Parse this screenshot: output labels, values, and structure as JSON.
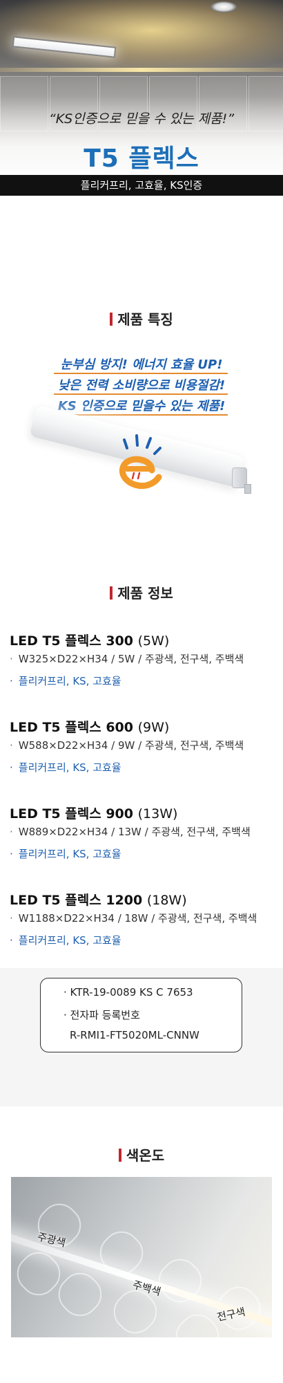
{
  "hero": {
    "quote": "“KS인증으로 믿을 수 있는 제품!”",
    "title": "T5 플렉스",
    "bar_text": "플리커프리, 고효율, KS인증"
  },
  "features": {
    "heading": "제품 특징",
    "lines": [
      "눈부심 방지!  에너지 효율 UP!",
      "낮은 전력 소비량으로 비용절감!",
      "KS 인증으로 믿을수 있는 제품!"
    ]
  },
  "info": {
    "heading": "제품 정보",
    "products": [
      {
        "name": "LED T5 플렉스 300",
        "watt": "(5W)",
        "spec": "W325×D22×H34  /  5W  /  주광색, 전구색, 주백색",
        "feature": "플리커프리, KS, 고효율"
      },
      {
        "name": "LED T5 플렉스 600",
        "watt": "(9W)",
        "spec": "W588×D22×H34  /  9W  /  주광색, 전구색, 주백색",
        "feature": "플리커프리, KS, 고효율"
      },
      {
        "name": "LED T5 플렉스 900",
        "watt": "(13W)",
        "spec": "W889×D22×H34  /  13W  /  주광색, 전구색, 주백색",
        "feature": "플리커프리, KS, 고효율"
      },
      {
        "name": "LED T5 플렉스 1200",
        "watt": "(18W)",
        "spec": "W1188×D22×H34  /  18W  /  주광색, 전구색, 주백색",
        "feature": "플리커프리, KS, 고효율"
      }
    ],
    "bullet": "·",
    "certs": {
      "line1": "· KTR-19-0089 KS C 7653",
      "line2": "· 전자파 등록번호",
      "line3": "R-RMI1-FT5020ML-CNNW"
    }
  },
  "color_temp": {
    "heading": "색온도",
    "labels": [
      "주광색",
      "주백색",
      "전구색"
    ]
  },
  "colors": {
    "title_blue": "#1d6fb8",
    "accent_red": "#c0272d",
    "feature_blue": "#1d5fb0",
    "underline_orange": "#e48a2c"
  }
}
